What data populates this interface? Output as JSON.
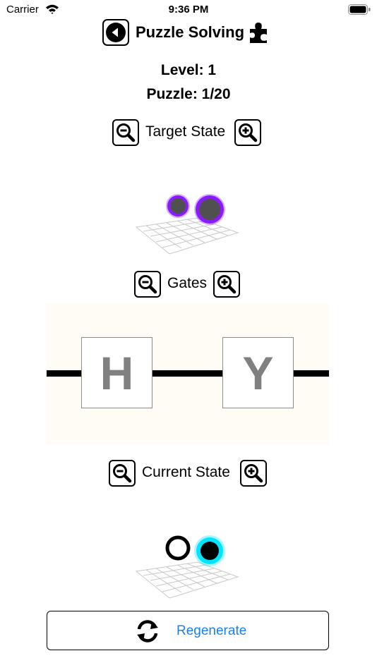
{
  "status_bar": {
    "carrier": "Carrier",
    "time": "9:36 PM"
  },
  "header": {
    "title": "Puzzle Solving",
    "back_icon": "back-arrow-icon",
    "puzzle_icon": "puzzle-piece-icon"
  },
  "level": {
    "label": "Level: 1"
  },
  "puzzle": {
    "label": "Puzzle: 1/20"
  },
  "target_state": {
    "label": "Target State"
  },
  "gates": {
    "label": "Gates",
    "items": [
      "H",
      "Y"
    ]
  },
  "current_state": {
    "label": "Current State"
  },
  "actions": {
    "regenerate_label": "Regenerate"
  },
  "colors": {
    "accent": "#1a7ff0",
    "target_qubit_ring": "#8a1aff",
    "current_qubit_ring": "#00e5ff"
  }
}
